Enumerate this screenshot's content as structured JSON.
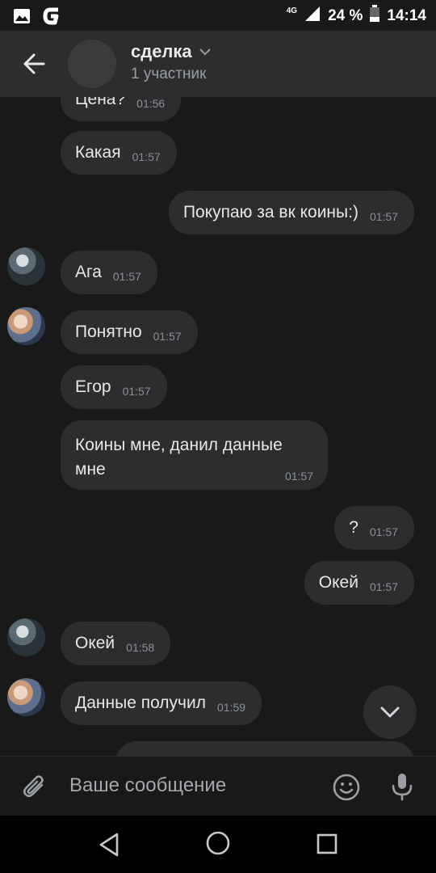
{
  "status_bar": {
    "network": "4G",
    "battery": "24 %",
    "time": "14:14"
  },
  "header": {
    "title": "сделка",
    "subtitle": "1 участник"
  },
  "messages": [
    {
      "text": "Цена?",
      "time": "01:56",
      "side": "in"
    },
    {
      "text": "Какая",
      "time": "01:57",
      "side": "in"
    },
    {
      "text": "Покупаю за вк коины:)",
      "time": "01:57",
      "side": "out"
    },
    {
      "text": "Ага",
      "time": "01:57",
      "side": "in"
    },
    {
      "text": "Понятно",
      "time": "01:57",
      "side": "in"
    },
    {
      "text": "Егор",
      "time": "01:57",
      "side": "in"
    },
    {
      "text": "Коины мне, данил данные мне",
      "time": "01:57",
      "side": "in"
    },
    {
      "text": "?",
      "time": "01:57",
      "side": "out"
    },
    {
      "text": "Окей",
      "time": "01:57",
      "side": "out"
    },
    {
      "text": "Окей",
      "time": "01:58",
      "side": "in"
    },
    {
      "text": "Данные получил",
      "time": "01:59",
      "side": "in"
    }
  ],
  "composer": {
    "placeholder": "Ваше сообщение"
  },
  "icons": {
    "back": "arrow-left-icon",
    "attach": "paperclip-icon",
    "emoji": "smiley-icon",
    "mic": "microphone-icon",
    "scroll_down": "chevron-down-icon"
  },
  "colors": {
    "background": "#19191a",
    "bubble": "#2c2d2e",
    "header": "#2c2d2e"
  }
}
